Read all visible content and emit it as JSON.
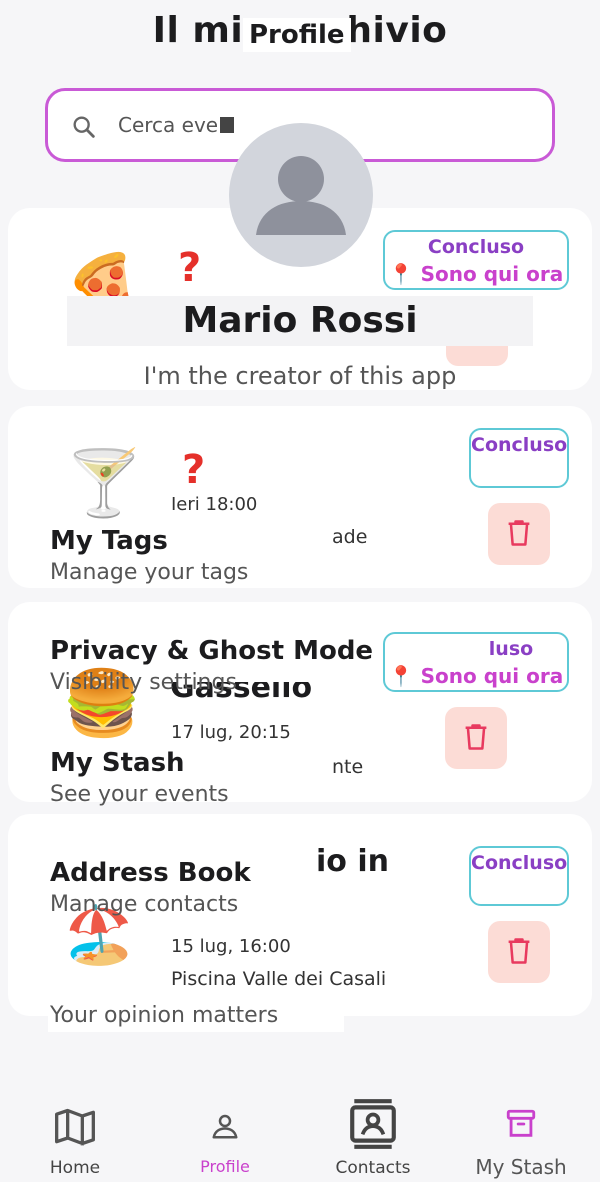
{
  "header": {
    "background_title": "Il mio archivio",
    "profile_title": "Profile"
  },
  "search": {
    "value": "Cerca eve"
  },
  "events": [
    {
      "badge_top": "Concluso",
      "badge_bottom": "Sono qui ora",
      "emoji_icon": "pizza-icon"
    },
    {
      "badge_top": "Concluso",
      "time": "Ieri 18:00",
      "place": "ade",
      "emoji_icon": "cocktail-icon"
    },
    {
      "badge_top": "luso",
      "badge_bottom": "Sono qui ora",
      "name": "Gassello",
      "time": "17 lug, 20:15",
      "place": "nte",
      "emoji_icon": "burger-icon"
    },
    {
      "badge_top": "Concluso",
      "name": "io in",
      "time": "15 lug, 16:00",
      "place": "Piscina Valle dei Casali",
      "emoji_icon": "beach-icon"
    }
  ],
  "profile": {
    "name": "Mario Rossi",
    "bio": "I'm the creator of this app"
  },
  "menu": [
    {
      "title": "My Tags",
      "subtitle": "Manage your tags"
    },
    {
      "title": "Privacy & Ghost Mode",
      "subtitle": "Visibility settings"
    },
    {
      "title": "My Stash",
      "subtitle": "See your events"
    },
    {
      "title": "Address Book",
      "subtitle": "Manage contacts"
    }
  ],
  "feedback": {
    "label": "Your opinion matters"
  },
  "nav": {
    "home": "Home",
    "profile": "Profile",
    "contacts": "Contacts",
    "stash": "My Stash"
  },
  "colors": {
    "accent": "#c941cc",
    "badge_border": "#5ec9d6",
    "trash_bg": "#fcdcd6",
    "trash_icon": "#e83a5f"
  }
}
